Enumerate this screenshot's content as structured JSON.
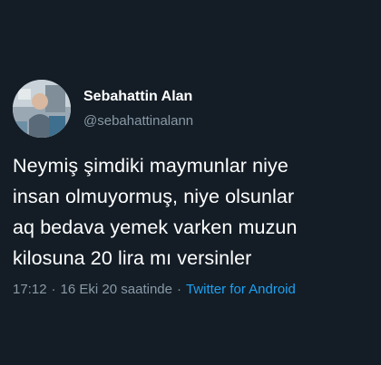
{
  "user": {
    "display_name": "Sebahattin Alan",
    "handle": "@sebahattinalann",
    "avatar_icon": "profile-photo"
  },
  "tweet": {
    "lines": [
      "Neymiş şimdiki maymunlar niye",
      "insan olmuyormuş, niye olsunlar",
      "aq bedava yemek varken muzun",
      "kilosuna 20 lira mı versinler"
    ]
  },
  "meta": {
    "time": "17:12",
    "separator": "·",
    "date": "16 Eki 20 saatinde",
    "source": "Twitter for Android"
  },
  "colors": {
    "background": "#141d26",
    "text": "#ffffff",
    "muted": "#8899a6",
    "link": "#1da1f2"
  }
}
